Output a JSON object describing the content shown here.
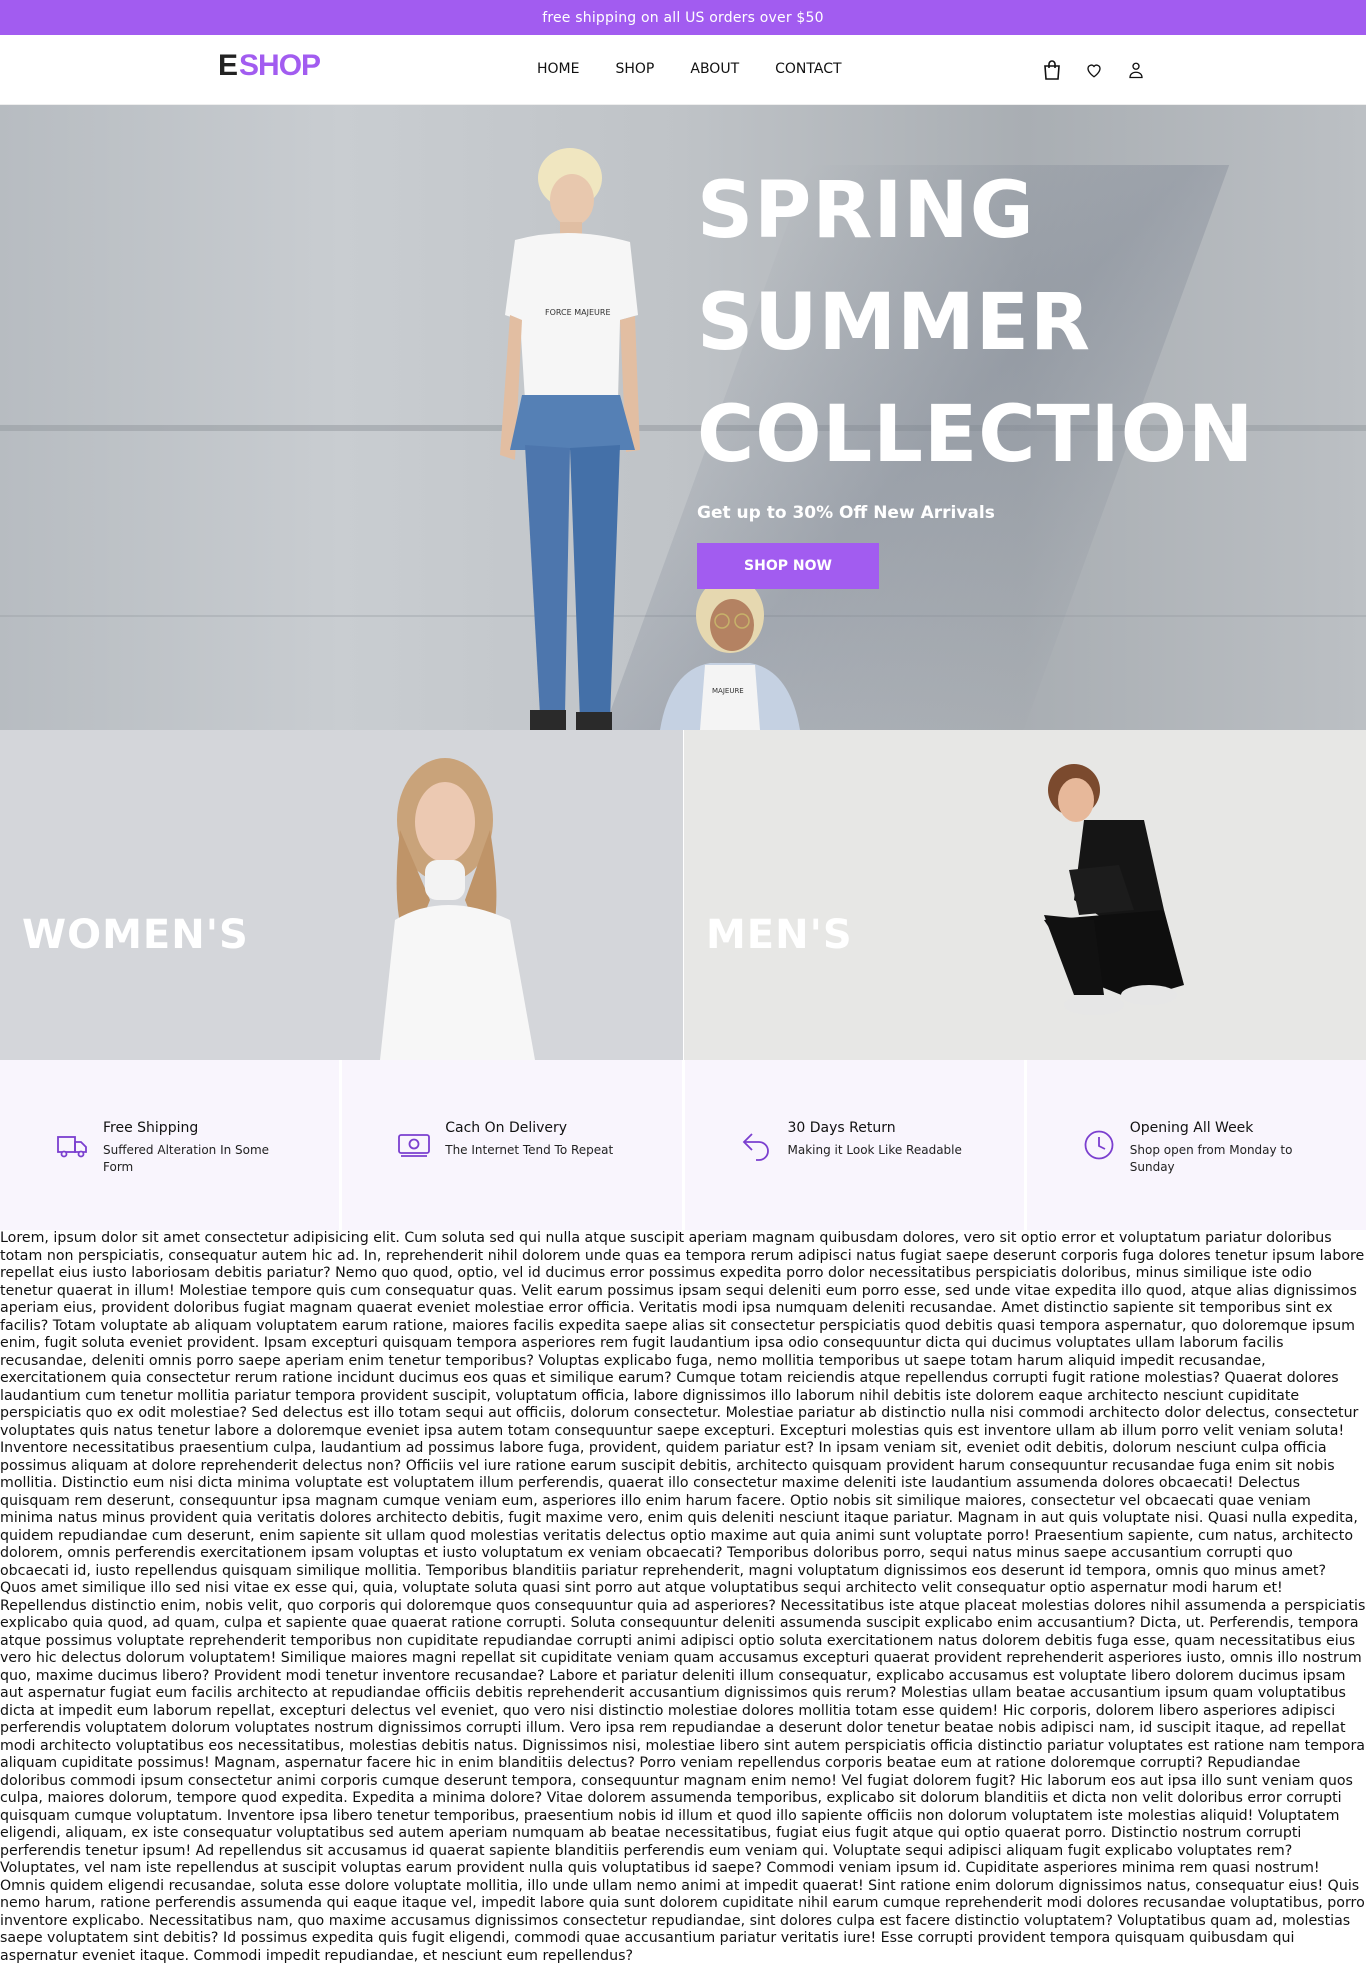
{
  "announcement": "free shipping on all US orders over $50",
  "header": {
    "logo_e": "E",
    "logo_shop": "SHOP",
    "nav": [
      "HOME",
      "SHOP",
      "ABOUT",
      "CONTACT"
    ],
    "icons": [
      "shopping-bag-icon",
      "heart-icon",
      "user-icon"
    ]
  },
  "hero": {
    "line1": "SPRING",
    "line2": "SUMMER",
    "line3": "COLLECTION",
    "subtitle": "Get up to 30% Off New Arrivals",
    "cta": "SHOP NOW",
    "shirt_text": "FORCE MAJEURE",
    "shirt_text2": "MAJEURE"
  },
  "categories": [
    {
      "label": "WOMEN'S"
    },
    {
      "label": "MEN'S"
    }
  ],
  "features": [
    {
      "title": "Free Shipping",
      "desc": "Suffered Alteration In Some Form",
      "icon": "truck-icon"
    },
    {
      "title": "Cach On Delivery",
      "desc": "The Internet Tend To Repeat",
      "icon": "cash-icon"
    },
    {
      "title": "30 Days Return",
      "desc": "Making it Look Like Readable",
      "icon": "return-arrow-icon"
    },
    {
      "title": "Opening All Week",
      "desc": "Shop open from Monday to Sunday",
      "icon": "clock-icon"
    }
  ],
  "colors": {
    "accent": "#a25cf0"
  },
  "lorem": "Lorem, ipsum dolor sit amet consectetur adipisicing elit. Cum soluta sed qui nulla atque suscipit aperiam magnam quibusdam dolores, vero sit optio error et voluptatum pariatur doloribus totam non perspiciatis, consequatur autem hic ad. In, reprehenderit nihil dolorem unde quas ea tempora rerum adipisci natus fugiat saepe deserunt corporis fuga dolores tenetur ipsum labore repellat eius iusto laboriosam debitis pariatur? Nemo quo quod, optio, vel id ducimus error possimus expedita porro dolor necessitatibus perspiciatis doloribus, minus similique iste odio tenetur quaerat in illum! Molestiae tempore quis cum consequatur quas. Velit earum possimus ipsam sequi deleniti eum porro esse, sed unde vitae expedita illo quod, atque alias dignissimos aperiam eius, provident doloribus fugiat magnam quaerat eveniet molestiae error officia. Veritatis modi ipsa numquam deleniti recusandae. Amet distinctio sapiente sit temporibus sint ex facilis? Totam voluptate ab aliquam voluptatem earum ratione, maiores facilis expedita saepe alias sit consectetur perspiciatis quod debitis quasi tempora aspernatur, quo doloremque ipsum enim, fugit soluta eveniet provident. Ipsam excepturi quisquam tempora asperiores rem fugit laudantium ipsa odio consequuntur dicta qui ducimus voluptates ullam laborum facilis recusandae, deleniti omnis porro saepe aperiam enim tenetur temporibus? Voluptas explicabo fuga, nemo mollitia temporibus ut saepe totam harum aliquid impedit recusandae, exercitationem quia consectetur rerum ratione incidunt ducimus eos quas et similique earum? Cumque totam reiciendis atque repellendus corrupti fugit ratione molestias? Quaerat dolores laudantium cum tenetur mollitia pariatur tempora provident suscipit, voluptatum officia, labore dignissimos illo laborum nihil debitis iste dolorem eaque architecto nesciunt cupiditate perspiciatis quo ex odit molestiae? Sed delectus est illo totam sequi aut officiis, dolorum consectetur. Molestiae pariatur ab distinctio nulla nisi commodi architecto dolor delectus, consectetur voluptates quis natus tenetur labore a doloremque eveniet ipsa autem totam consequuntur saepe excepturi. Excepturi molestias quis est inventore ullam ab illum porro velit veniam soluta! Inventore necessitatibus praesentium culpa, laudantium ad possimus labore fuga, provident, quidem pariatur est? In ipsam veniam sit, eveniet odit debitis, dolorum nesciunt culpa officia possimus aliquam at dolore reprehenderit delectus non? Officiis vel iure ratione earum suscipit debitis, architecto quisquam provident harum consequuntur recusandae fuga enim sit nobis mollitia. Distinctio eum nisi dicta minima voluptate est voluptatem illum perferendis, quaerat illo consectetur maxime deleniti iste laudantium assumenda dolores obcaecati! Delectus quisquam rem deserunt, consequuntur ipsa magnam cumque veniam eum, asperiores illo enim harum facere. Optio nobis sit similique maiores, consectetur vel obcaecati quae veniam minima natus minus provident quia veritatis dolores architecto debitis, fugit maxime vero, enim quis deleniti nesciunt itaque pariatur. Magnam in aut quis voluptate nisi. Quasi nulla expedita, quidem repudiandae cum deserunt, enim sapiente sit ullam quod molestias veritatis delectus optio maxime aut quia animi sunt voluptate porro! Praesentium sapiente, cum natus, architecto dolorem, omnis perferendis exercitationem ipsam voluptas et iusto voluptatum ex veniam obcaecati? Temporibus doloribus porro, sequi natus minus saepe accusantium corrupti quo obcaecati id, iusto repellendus quisquam similique mollitia. Temporibus blanditiis pariatur reprehenderit, magni voluptatum dignissimos eos deserunt id tempora, omnis quo minus amet? Quos amet similique illo sed nisi vitae ex esse qui, quia, voluptate soluta quasi sint porro aut atque voluptatibus sequi architecto velit consequatur optio aspernatur modi harum et! Repellendus distinctio enim, nobis velit, quo corporis qui doloremque quos consequuntur quia ad asperiores? Necessitatibus iste atque placeat molestias dolores nihil assumenda a perspiciatis explicabo quia quod, ad quam, culpa et sapiente quae quaerat ratione corrupti. Soluta consequuntur deleniti assumenda suscipit explicabo enim accusantium? Dicta, ut. Perferendis, tempora atque possimus voluptate reprehenderit temporibus non cupiditate repudiandae corrupti animi adipisci optio soluta exercitationem natus dolorem debitis fuga esse, quam necessitatibus eius vero hic delectus dolorum voluptatem! Similique maiores magni repellat sit cupiditate veniam quam accusamus excepturi quaerat provident reprehenderit asperiores iusto, omnis illo nostrum quo, maxime ducimus libero? Provident modi tenetur inventore recusandae? Labore et pariatur deleniti illum consequatur, explicabo accusamus est voluptate libero dolorem ducimus ipsam aut aspernatur fugiat eum facilis architecto at repudiandae officiis debitis reprehenderit accusantium dignissimos quis rerum? Molestias ullam beatae accusantium ipsum quam voluptatibus dicta at impedit eum laborum repellat, excepturi delectus vel eveniet, quo vero nisi distinctio molestiae dolores mollitia totam esse quidem! Hic corporis, dolorem libero asperiores adipisci perferendis voluptatem dolorum voluptates nostrum dignissimos corrupti illum. Vero ipsa rem repudiandae a deserunt dolor tenetur beatae nobis adipisci nam, id suscipit itaque, ad repellat modi architecto voluptatibus eos necessitatibus, molestias debitis natus. Dignissimos nisi, molestiae libero sint autem perspiciatis officia distinctio pariatur voluptates est ratione nam tempora aliquam cupiditate possimus! Magnam, aspernatur facere hic in enim blanditiis delectus? Porro veniam repellendus corporis beatae eum at ratione doloremque corrupti? Repudiandae doloribus commodi ipsum consectetur animi corporis cumque deserunt tempora, consequuntur magnam enim nemo! Vel fugiat dolorem fugit? Hic laborum eos aut ipsa illo sunt veniam quos culpa, maiores dolorum, tempore quod expedita. Expedita a minima dolore? Vitae dolorem assumenda temporibus, explicabo sit dolorum blanditiis et dicta non velit doloribus error corrupti quisquam cumque voluptatum. Inventore ipsa libero tenetur temporibus, praesentium nobis id illum et quod illo sapiente officiis non dolorum voluptatem iste molestias aliquid! Voluptatem eligendi, aliquam, ex iste consequatur voluptatibus sed autem aperiam numquam ab beatae necessitatibus, fugiat eius fugit atque qui optio quaerat porro. Distinctio nostrum corrupti perferendis tenetur ipsum! Ad repellendus sit accusamus id quaerat sapiente blanditiis perferendis eum veniam qui. Voluptate sequi adipisci aliquam fugit explicabo voluptates rem? Voluptates, vel nam iste repellendus at suscipit voluptas earum provident nulla quis voluptatibus id saepe? Commodi veniam ipsum id. Cupiditate asperiores minima rem quasi nostrum! Omnis quidem eligendi recusandae, soluta esse dolore voluptate mollitia, illo unde ullam nemo animi at impedit quaerat! Sint ratione enim dolorum dignissimos natus, consequatur eius! Quis nemo harum, ratione perferendis assumenda qui eaque itaque vel, impedit labore quia sunt dolorem cupiditate nihil earum cumque reprehenderit modi dolores recusandae voluptatibus, porro inventore explicabo. Necessitatibus nam, quo maxime accusamus dignissimos consectetur repudiandae, sint dolores culpa est facere distinctio voluptatem? Voluptatibus quam ad, molestias saepe voluptatem sint debitis? Id possimus expedita quis fugit eligendi, commodi quae accusantium pariatur veritatis iure! Esse corrupti provident tempora quisquam quibusdam qui aspernatur eveniet itaque. Commodi impedit repudiandae, et nesciunt eum repellendus?"
}
